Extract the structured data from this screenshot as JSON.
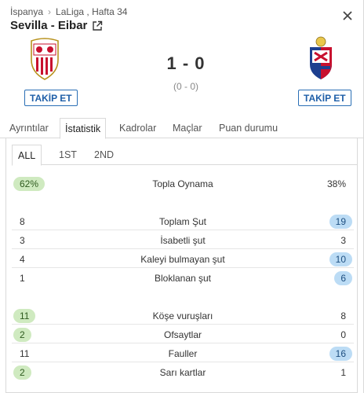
{
  "breadcrumb": {
    "country": "İspanya",
    "league": "LaLiga , Hafta 34"
  },
  "match": {
    "title": "Sevilla - Eibar",
    "score": "1 - 0",
    "halftime": "(0 - 0)"
  },
  "follow_label": "TAKİP ET",
  "tabs": [
    "Ayrıntılar",
    "İstatistik",
    "Kadrolar",
    "Maçlar",
    "Puan durumu"
  ],
  "subtabs": [
    "ALL",
    "1ST",
    "2ND"
  ],
  "colors": {
    "accent": "#2a6fb5",
    "home_highlight": "#cfeac0",
    "away_highlight": "#bcdcf5"
  },
  "stats": [
    {
      "label": "Topla Oynama",
      "home": "62%",
      "away": "38%",
      "leader": "home"
    },
    {
      "label": "Toplam Şut",
      "home": "8",
      "away": "19",
      "leader": "away"
    },
    {
      "label": "İsabetli şut",
      "home": "3",
      "away": "3",
      "leader": "none"
    },
    {
      "label": "Kaleyi bulmayan şut",
      "home": "4",
      "away": "10",
      "leader": "away"
    },
    {
      "label": "Bloklanan şut",
      "home": "1",
      "away": "6",
      "leader": "away"
    },
    {
      "label": "Köşe vuruşları",
      "home": "11",
      "away": "8",
      "leader": "home"
    },
    {
      "label": "Ofsaytlar",
      "home": "2",
      "away": "0",
      "leader": "home"
    },
    {
      "label": "Fauller",
      "home": "11",
      "away": "16",
      "leader": "away"
    },
    {
      "label": "Sarı kartlar",
      "home": "2",
      "away": "1",
      "leader": "home"
    }
  ]
}
